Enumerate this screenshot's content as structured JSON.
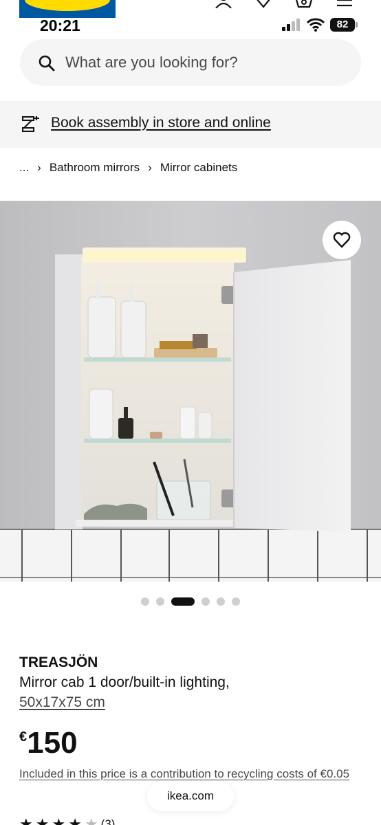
{
  "status_bar": {
    "time": "20:21",
    "battery": "82"
  },
  "search": {
    "placeholder": "What are you looking for?"
  },
  "assembly_banner": {
    "link_text": "Book assembly in store and online"
  },
  "breadcrumb": {
    "ellipsis": "...",
    "separator": "›",
    "items": [
      "Bathroom mirrors",
      "Mirror cabinets"
    ]
  },
  "carousel": {
    "total": 6,
    "active_index": 2
  },
  "product": {
    "name": "TREASJÖN",
    "description": "Mirror cab 1 door/built-in lighting,",
    "size": "50x17x75 cm",
    "price_currency": "€",
    "price_value": "150",
    "recycling_note": "Included in this price is a contribution to recycling costs of €0.05"
  },
  "browser": {
    "url": "ikea.com"
  },
  "rating": {
    "count": "(3)"
  },
  "icons": {
    "search": "search-icon",
    "assembly": "assembly-tool-icon",
    "favourite": "heart-icon",
    "account": "person-icon",
    "wishlist": "heart-icon",
    "bag": "shopping-bag-icon",
    "menu": "hamburger-menu-icon"
  },
  "colors": {
    "brand_blue": "#0058a3",
    "brand_yellow": "#ffdb00",
    "text": "#111111",
    "muted_text": "#484848",
    "panel_bg": "#f5f5f5"
  }
}
